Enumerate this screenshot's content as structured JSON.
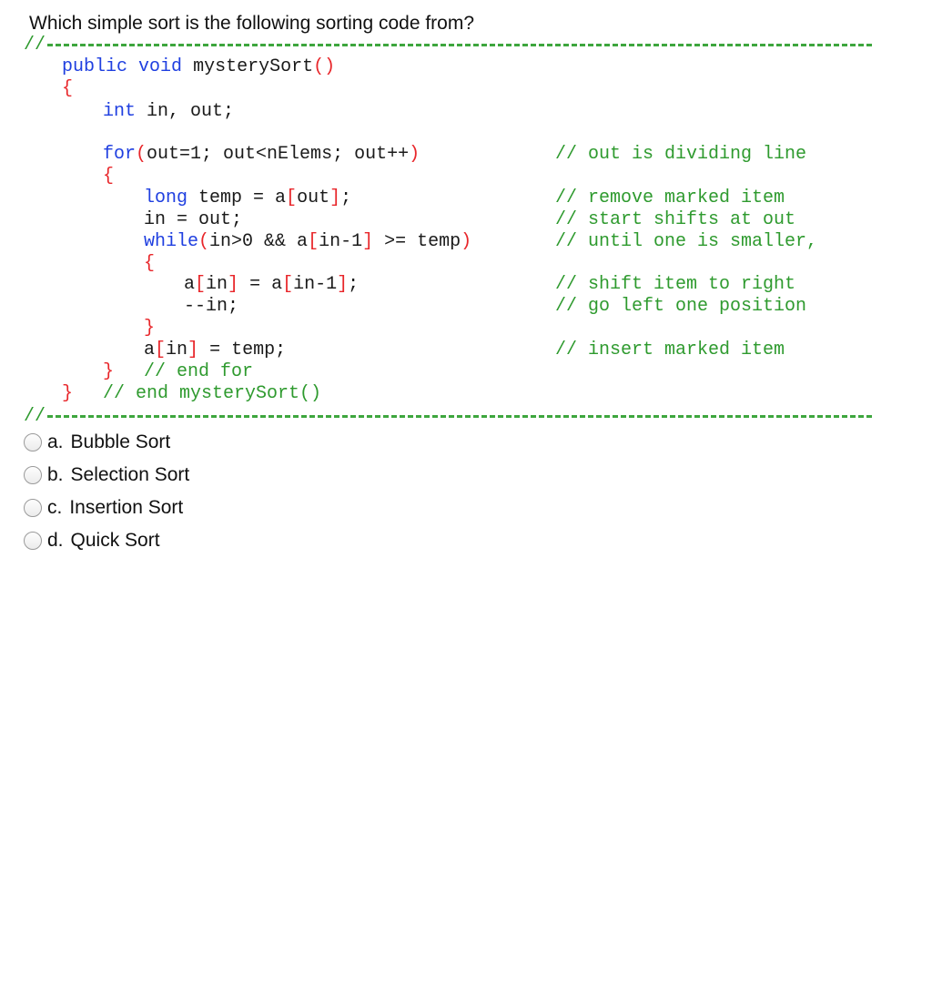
{
  "question": "Which simple sort is the following sorting code from?",
  "code": {
    "divider_prefix": "//",
    "lines": {
      "l1_kw1": "public",
      "l1_kw2": "void",
      "l1_name": "mysterySort",
      "l1_paren": "()",
      "l2_brace": "{",
      "l3_kw": "int",
      "l3_rest": " in, out;",
      "l4_kw": "for",
      "l4_open": "(",
      "l4_rest": "out=1; out<nElems; out++",
      "l4_close": ")",
      "l4_comment": "// out is dividing line",
      "l5_brace": "{",
      "l6_kw": "long",
      "l6_a": " temp = a",
      "l6_ob": "[",
      "l6_b": "out",
      "l6_cb": "]",
      "l6_c": ";",
      "l6_comment": "// remove marked item",
      "l7_text": "in = out;",
      "l7_comment": "// start shifts at out",
      "l8_kw": "while",
      "l8_open": "(",
      "l8_a": "in>0 && a",
      "l8_ob": "[",
      "l8_b": "in-1",
      "l8_cb": "]",
      "l8_c": " >= temp",
      "l8_close": ")",
      "l8_comment": "// until one is smaller,",
      "l9_brace": "{",
      "l10_a": "a",
      "l10_ob": "[",
      "l10_b": "in",
      "l10_cb": "]",
      "l10_c": " = a",
      "l10_ob2": "[",
      "l10_d": "in-1",
      "l10_cb2": "]",
      "l10_e": ";",
      "l10_comment": "// shift item to right",
      "l11_text": "--in;",
      "l11_comment": "// go left one position",
      "l12_brace": "}",
      "l13_a": "a",
      "l13_ob": "[",
      "l13_b": "in",
      "l13_cb": "]",
      "l13_c": " = temp;",
      "l13_comment": "// insert marked item",
      "l14_brace": "}",
      "l14_comment": "// end for",
      "l15_brace": "}",
      "l15_comment": "// end mysterySort()"
    }
  },
  "options": [
    {
      "letter": "a.",
      "label": "Bubble Sort"
    },
    {
      "letter": "b.",
      "label": "Selection Sort"
    },
    {
      "letter": "c.",
      "label": "Insertion Sort"
    },
    {
      "letter": "d.",
      "label": "Quick Sort"
    }
  ],
  "colors": {
    "keyword": "#1f3fe0",
    "bracket": "#e8262a",
    "comment": "#2e9a2e"
  }
}
